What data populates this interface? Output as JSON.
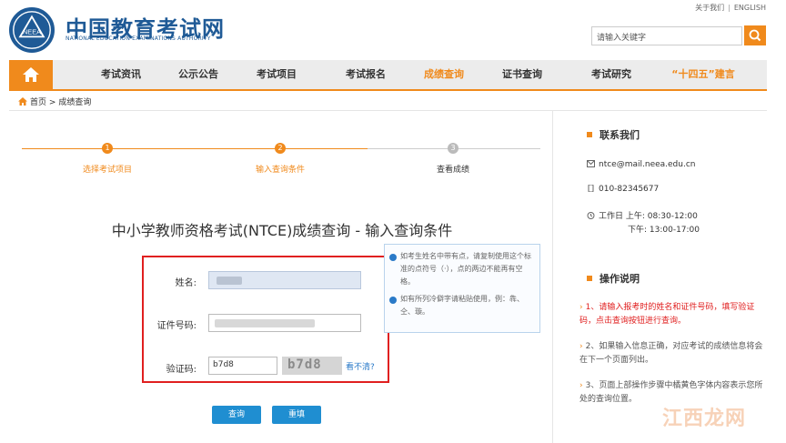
{
  "header": {
    "site_name": "中国教育考试网",
    "site_sub": "NATIONAL EDUCATION EXAMINATIONS AUTHORITY",
    "logo_text": "NEEA",
    "top_links": [
      "关于我们",
      "ENGLISH"
    ],
    "search_placeholder": "请输入关键字"
  },
  "nav": {
    "items": [
      {
        "label": "考试资讯"
      },
      {
        "label": "公示公告"
      },
      {
        "label": "考试项目"
      },
      {
        "label": "考试报名"
      },
      {
        "label": "成绩查询"
      },
      {
        "label": "证书查询"
      },
      {
        "label": "考试研究"
      },
      {
        "label": "“十四五”建言"
      }
    ],
    "active_index": 4
  },
  "breadcrumb": {
    "home": "首页",
    "separator": ">",
    "current": "成绩查询"
  },
  "steps": [
    {
      "num": "1",
      "label": "选择考试项目",
      "state": "done"
    },
    {
      "num": "2",
      "label": "输入查询条件",
      "state": "current"
    },
    {
      "num": "3",
      "label": "查看成绩",
      "state": "todo"
    }
  ],
  "page_title": "中小学教师资格考试(NTCE)成绩查询 - 输入查询条件",
  "form": {
    "name_label": "姓名:",
    "id_label": "证件号码:",
    "captcha_label": "验证码:",
    "captcha_value": "b7d8",
    "captcha_image_text": "b7d8",
    "refresh_label": "看不清?"
  },
  "tips": [
    "如考生姓名中带有点，请复制使用这个标准的点符号（·），点的两边不能再有空格。",
    "如有所列冷僻字请粘贴使用，例：犇、仝、璇。"
  ],
  "buttons": {
    "query": "查询",
    "reset": "重填"
  },
  "contact": {
    "title": "联系我们",
    "email": "ntce@mail.neea.edu.cn",
    "phone": "010-82345677",
    "hours_label": "工作日 上午: 08:30-12:00",
    "hours_pm": "下午: 13:00-17:00"
  },
  "instructions": {
    "title": "操作说明",
    "items": [
      "1、请输入报考时的姓名和证件号码，填写验证码，点击查询按钮进行查询。",
      "2、如果输入信息正确，对应考试的成绩信息将会在下一个页面列出。",
      "3、页面上部操作步骤中橘黄色字体内容表示您所处的查询位置。"
    ]
  },
  "watermark": "江西龙网",
  "colors": {
    "brand_blue": "#1f5a96",
    "accent_orange": "#f08a1c",
    "highlight_red": "#e02020",
    "button_blue": "#1f8ed1"
  }
}
